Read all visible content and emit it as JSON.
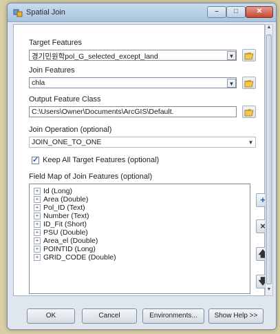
{
  "window": {
    "title": "Spatial Join"
  },
  "target_features": {
    "label": "Target Features",
    "value": "경기민원학pol_G_selected_except_land"
  },
  "join_features": {
    "label": "Join Features",
    "value": "chla"
  },
  "output_feature_class": {
    "label": "Output Feature Class",
    "value": "C:\\Users\\Owner\\Documents\\ArcGIS\\Default."
  },
  "join_operation": {
    "label": "Join Operation (optional)",
    "value": "JOIN_ONE_TO_ONE"
  },
  "keep_all": {
    "label": "Keep All Target Features (optional)",
    "checked": true
  },
  "field_map": {
    "label": "Field Map of Join Features (optional)",
    "items": [
      "Id (Long)",
      "Area (Double)",
      "Pol_ID (Text)",
      "Number (Text)",
      "ID_Fit (Short)",
      "PSU (Double)",
      "Area_el (Double)",
      "POINTID (Long)",
      "GRID_CODE (Double)"
    ]
  },
  "buttons": {
    "ok": "OK",
    "cancel": "Cancel",
    "environments": "Environments...",
    "show_help": "Show Help >>"
  },
  "icons": {
    "title": "spatial-join-icon",
    "folder": "folder-open-icon",
    "add": "plus-icon",
    "remove": "x-icon",
    "up": "arrow-up-icon",
    "down": "arrow-down-icon"
  }
}
